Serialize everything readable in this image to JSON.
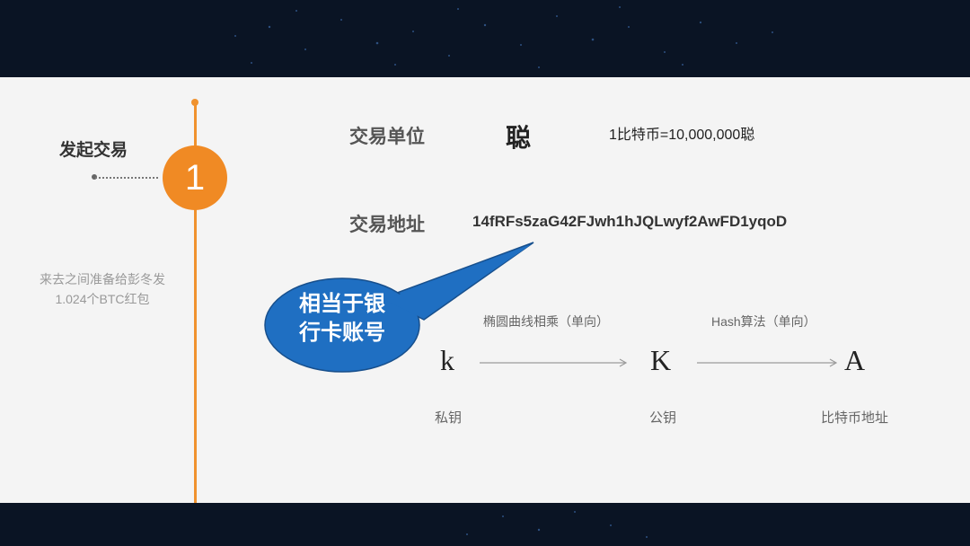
{
  "step": {
    "number": "1",
    "title": "发起交易",
    "description": "来去之间准备给彭冬发1.024个BTC红包"
  },
  "unit": {
    "label": "交易单位",
    "value": "聪",
    "note": "1比特币=10,000,000聪"
  },
  "address": {
    "label": "交易地址",
    "value": "14fRFs5zaG42FJwh1hJQLwyf2AwFD1yqoD"
  },
  "callout": {
    "line1": "相当于银",
    "line2": "行卡账号",
    "fill_color": "#1f6fc2"
  },
  "flow": {
    "nodes": [
      {
        "symbol": "k",
        "name": "私钥"
      },
      {
        "symbol": "K",
        "name": "公钥"
      },
      {
        "symbol": "A",
        "name": "比特币地址"
      }
    ],
    "edges": [
      {
        "label": "椭圆曲线相乘（单向）"
      },
      {
        "label": "Hash算法（单向）"
      }
    ]
  },
  "colors": {
    "accent": "#f08a24",
    "background": "#0a1424",
    "panel": "#f4f4f4"
  }
}
